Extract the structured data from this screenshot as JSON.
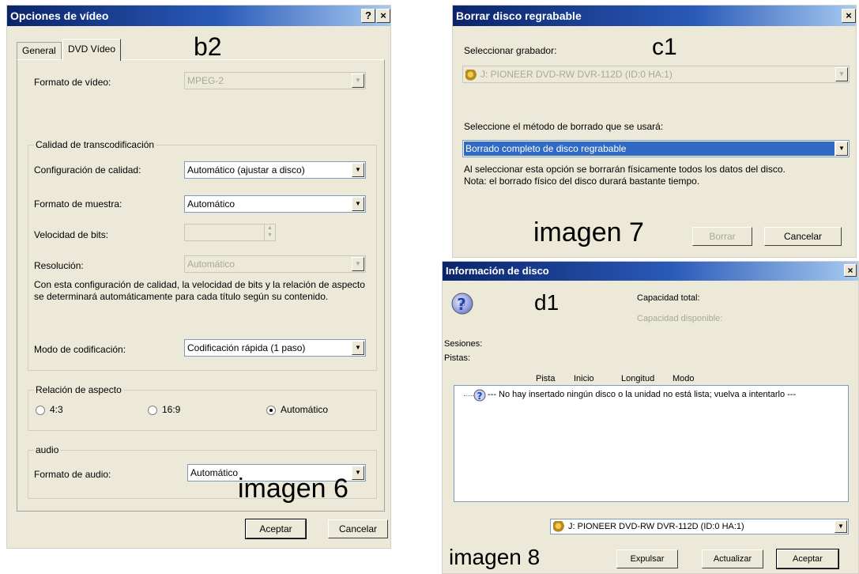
{
  "win1": {
    "title": "Opciones de vídeo",
    "help": "?",
    "close": "×",
    "tabs": [
      "General",
      "DVD Vídeo"
    ],
    "marker": "b2",
    "video_format_label": "Formato de vídeo:",
    "video_format_value": "MPEG-2",
    "quality_group": "Calidad de transcodificación",
    "quality_setting_label": "Configuración de calidad:",
    "quality_setting_value": "Automático (ajustar a disco)",
    "sample_format_label": "Formato de muestra:",
    "sample_format_value": "Automático",
    "bitrate_label": "Velocidad de bits:",
    "resolution_label": "Resolución:",
    "resolution_value": "Automático",
    "note": "Con esta configuración de calidad, la velocidad de bits y la relación de aspecto se determinará automáticamente para cada título según su contenido.",
    "encoding_mode_label": "Modo de codificación:",
    "encoding_mode_value": "Codificación rápida (1 paso)",
    "aspect_group": "Relación de aspecto",
    "aspect_options": [
      "4:3",
      "16:9",
      "Automático"
    ],
    "aspect_selected": "Automático",
    "audio_group": "audio",
    "audio_format_label": "Formato de audio:",
    "audio_format_value": "Automático",
    "caption": "imagen 6",
    "ok": "Aceptar",
    "cancel": "Cancelar"
  },
  "win2": {
    "title": "Borrar disco regrabable",
    "close": "×",
    "marker": "c1",
    "recorder_label": "Seleccionar grabador:",
    "recorder_value": "J: PIONEER  DVD-RW  DVR-112D (ID:0 HA:1)",
    "method_label": "Seleccione el método de borrado que se usará:",
    "method_value": "Borrado completo de disco regrabable",
    "info_line1": "Al seleccionar esta opción se borrarán físicamente todos los datos del disco.",
    "info_line2": "Nota: el borrado físico del disco durará bastante tiempo.",
    "caption": "imagen 7",
    "erase": "Borrar",
    "cancel": "Cancelar"
  },
  "win3": {
    "title": "Información de disco",
    "close": "×",
    "marker": "d1",
    "total_capacity_label": "Capacidad total:",
    "available_capacity_label": "Capacidad disponible:",
    "sessions_label": "Sesiones:",
    "tracks_label": "Pistas:",
    "columns": [
      "Pista",
      "Inicio",
      "Longitud",
      "Modo"
    ],
    "list_message": "--- No hay insertado ningún disco o la unidad no está lista; vuelva a intentarlo ---",
    "drive_value": "J: PIONEER  DVD-RW  DVR-112D (ID:0 HA:1)",
    "caption": "imagen 8",
    "eject": "Expulsar",
    "refresh": "Actualizar",
    "ok": "Aceptar"
  }
}
